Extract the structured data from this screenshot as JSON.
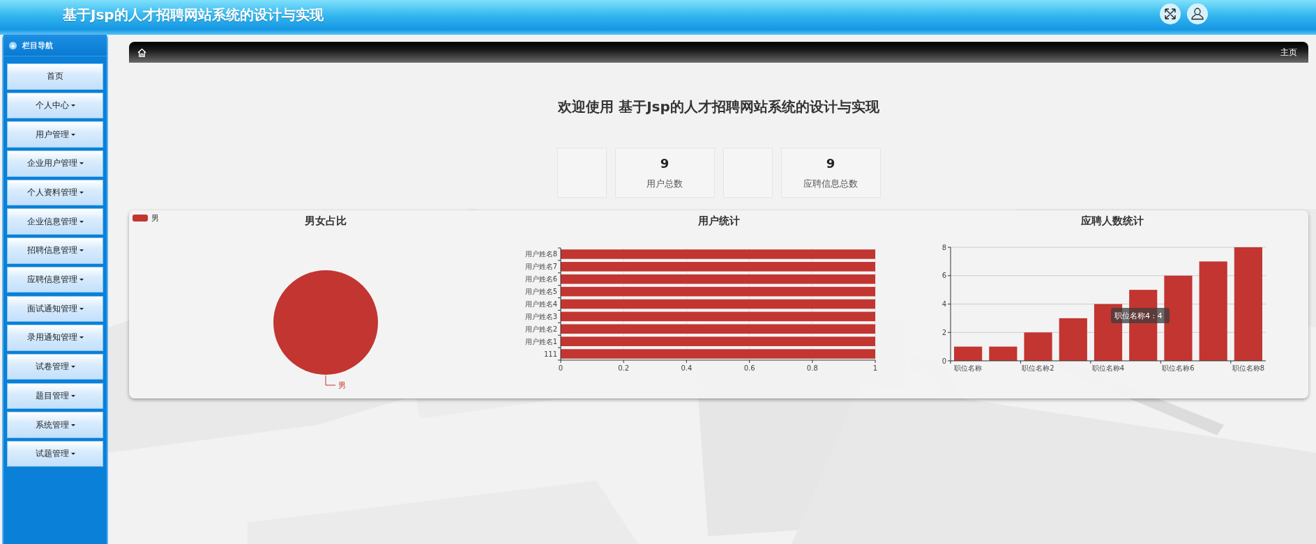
{
  "header": {
    "title": "基于Jsp的人才招聘网站系统的设计与实现"
  },
  "sidebar": {
    "title": "栏目导航",
    "items": [
      {
        "label": "首页",
        "kind": "link"
      },
      {
        "label": "个人中心",
        "kind": "menu"
      },
      {
        "label": "用户管理",
        "kind": "menu"
      },
      {
        "label": "企业用户管理",
        "kind": "menu"
      },
      {
        "label": "个人资料管理",
        "kind": "menu"
      },
      {
        "label": "企业信息管理",
        "kind": "menu"
      },
      {
        "label": "招聘信息管理",
        "kind": "menu"
      },
      {
        "label": "应聘信息管理",
        "kind": "menu"
      },
      {
        "label": "面试通知管理",
        "kind": "menu"
      },
      {
        "label": "录用通知管理",
        "kind": "menu"
      },
      {
        "label": "试卷管理",
        "kind": "menu"
      },
      {
        "label": "题目管理",
        "kind": "menu"
      },
      {
        "label": "系统管理",
        "kind": "menu"
      },
      {
        "label": "试题管理",
        "kind": "menu"
      }
    ]
  },
  "breadcrumb": {
    "current": "主页"
  },
  "welcome": "欢迎使用 基于Jsp的人才招聘网站系统的设计与实现",
  "stat_cards": [
    {
      "kind": "empty"
    },
    {
      "kind": "stat",
      "value": "9",
      "label": "用户总数"
    },
    {
      "kind": "empty"
    },
    {
      "kind": "stat",
      "value": "9",
      "label": "应聘信息总数"
    }
  ],
  "charts": [
    {
      "legend": [
        {
          "label": "男",
          "color": "#c23531"
        }
      ],
      "chart_data": {
        "type": "pie",
        "title": "男女占比",
        "categories": [
          "男"
        ]
      }
    },
    {
      "chart_data": {
        "type": "bar",
        "orientation": "horizontal",
        "title": "用户统计",
        "categories": [
          "用户姓名8",
          "用户姓名7",
          "用户姓名6",
          "用户姓名5",
          "用户姓名4",
          "用户姓名3",
          "用户姓名2",
          "用户姓名1",
          "111"
        ],
        "series": [
          {
            "color": "#c23531",
            "values": [
              1,
              1,
              1,
              1,
              1,
              1,
              1,
              1,
              1
            ]
          }
        ],
        "xlim": [
          0,
          1
        ],
        "xticks": [
          0,
          0.2,
          0.4,
          0.6,
          0.8,
          1
        ],
        "grid": true
      }
    },
    {
      "chart_data": {
        "type": "bar",
        "orientation": "vertical",
        "title": "应聘人数统计",
        "categories": [
          "职位名称",
          null,
          "职位名称2",
          null,
          "职位名称4",
          null,
          "职位名称6",
          null,
          "职位名称8"
        ],
        "series": [
          {
            "color": "#c23531",
            "values": [
              1,
              1,
              2,
              3,
              4,
              5,
              6,
              7,
              8
            ]
          }
        ],
        "ylim": [
          0,
          8
        ],
        "yticks": [
          0,
          2,
          4,
          6,
          8
        ],
        "grid": true,
        "annotations": [
          "职位名称4 : 4"
        ]
      }
    }
  ]
}
